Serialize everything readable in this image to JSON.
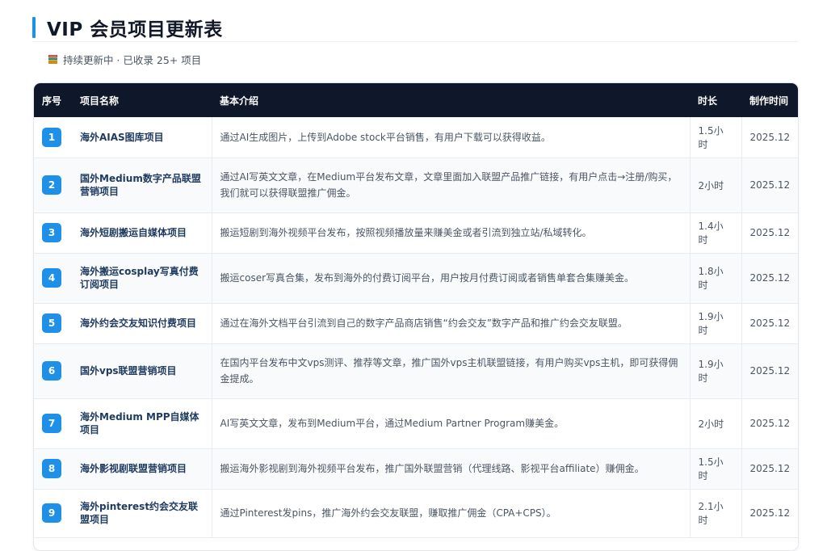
{
  "header": {
    "title": "VIP 会员项目更新表",
    "subtitle": "持续更新中 · 已收录 25+ 项目",
    "subtitle_icon": "book-icon"
  },
  "colors": {
    "accent": "#1e90e8",
    "table_header_bg": "#0f172a",
    "name_text": "#1e3a5f"
  },
  "table": {
    "columns": [
      "序号",
      "项目名称",
      "基本介绍",
      "时长",
      "制作时间"
    ],
    "rows": [
      {
        "num": "1",
        "name": "海外AIAS图库项目",
        "desc": "通过AI生成图片，上传到Adobe stock平台销售，有用户下载可以获得收益。",
        "time": "1.5小时",
        "date": "2025.12"
      },
      {
        "num": "2",
        "name": "国外Medium数字产品联盟营销项目",
        "desc": "通过AI写英文文章，在Medium平台发布文章，文章里面加入联盟产品推广链接，有用户点击→注册/购买，我们就可以获得联盟推广佣金。",
        "time": "2小时",
        "date": "2025.12"
      },
      {
        "num": "3",
        "name": "海外短剧搬运自媒体项目",
        "desc": "搬运短剧到海外视频平台发布，按照视频播放量来赚美金或者引流到独立站/私域转化。",
        "time": "1.4小时",
        "date": "2025.12"
      },
      {
        "num": "4",
        "name": "海外搬运cosplay写真付费订阅项目",
        "desc": "搬运coser写真合集，发布到海外的付费订阅平台，用户按月付费订阅或者销售单套合集赚美金。",
        "time": "1.8小时",
        "date": "2025.12"
      },
      {
        "num": "5",
        "name": "海外约会交友知识付费项目",
        "desc": "通过在海外文档平台引流到自己的数字产品商店销售“约会交友”数字产品和推广约会交友联盟。",
        "time": "1.9小时",
        "date": "2025.12"
      },
      {
        "num": "6",
        "name": "国外vps联盟营销项目",
        "desc": "在国内平台发布中文vps测评、推荐等文章，推广国外vps主机联盟链接，有用户购买vps主机，即可获得佣金提成。",
        "time": "1.9小时",
        "date": "2025.12"
      },
      {
        "num": "7",
        "name": "海外Medium MPP自媒体项目",
        "desc": "AI写英文文章，发布到Medium平台，通过Medium Partner Program赚美金。",
        "time": "2小时",
        "date": "2025.12"
      },
      {
        "num": "8",
        "name": "海外影视剧联盟营销项目",
        "desc": "搬运海外影视剧到海外视频平台发布，推广国外联盟营销（代理线路、影视平台affiliate）赚佣金。",
        "time": "1.5小时",
        "date": "2025.12"
      },
      {
        "num": "9",
        "name": "海外pinterest约会交友联盟项目",
        "desc": "通过Pinterest发pins，推广海外约会交友联盟，赚取推广佣金（CPA+CPS）。",
        "time": "2.1小时",
        "date": "2025.12"
      }
    ]
  }
}
